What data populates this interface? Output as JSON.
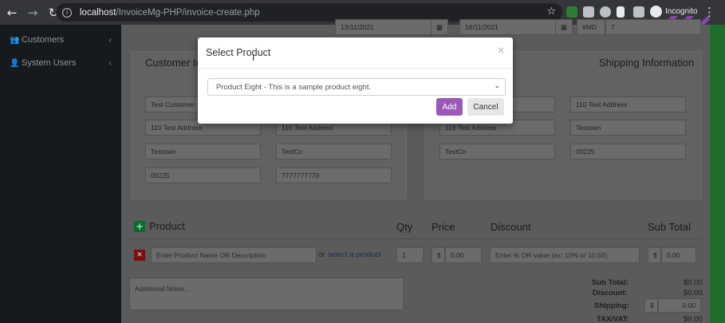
{
  "browser": {
    "url_host": "localhost",
    "url_path": "/InvoiceMg-PHP/invoice-create.php",
    "profile_label": "Incognito"
  },
  "sidebar": {
    "items": [
      {
        "label": "Customers",
        "icon": "users-icon"
      },
      {
        "label": "System Users",
        "icon": "user-icon"
      }
    ]
  },
  "invoice_meta": {
    "invoice_date": "13/11/2021",
    "due_date": "16/11/2021",
    "prefix": "#MD",
    "number": "7"
  },
  "customer": {
    "heading": "Customer In",
    "name": "Test Customer",
    "address_1": "110 Test Address",
    "address_2": "116 Test Address",
    "town": "Testown",
    "county": "TestCn",
    "postcode": "00225",
    "phone": "7777777770"
  },
  "shipping": {
    "heading": "Shipping Information",
    "address_1": "110 Test Address",
    "address_2": "116 Test Address",
    "town": "Testown",
    "county": "TestCn",
    "postcode": "00225"
  },
  "items": {
    "headers": {
      "product": "Product",
      "qty": "Qty",
      "price": "Price",
      "discount": "Discount",
      "subtotal": "Sub Total"
    },
    "row": {
      "product_placeholder": "Enter Product Name OR Description",
      "or_text": "or",
      "select_link": "select a product",
      "qty": "1",
      "currency": "$",
      "price": "0.00",
      "discount_placeholder": "Enter % OR value (ex: 10% or 10.50)",
      "subtotal": "0.00"
    }
  },
  "notes": {
    "placeholder": "Additional Notes..."
  },
  "totals": {
    "subtotal_label": "Sub Total:",
    "subtotal": "$0.00",
    "discount_label": "Discount:",
    "discount": "$0.00",
    "shipping_label": "Shipping:",
    "shipping_currency": "$",
    "shipping": "0.00",
    "tax_label": "TAX/VAT:",
    "tax": "$0.00"
  },
  "modal": {
    "title": "Select Product",
    "close": "×",
    "selected_option": "Product Eight - This is a sample product eight.",
    "add_label": "Add",
    "cancel_label": "Cancel"
  },
  "colors": {
    "add_button": "#9b59b6",
    "accent_green": "#1f6f2c"
  }
}
